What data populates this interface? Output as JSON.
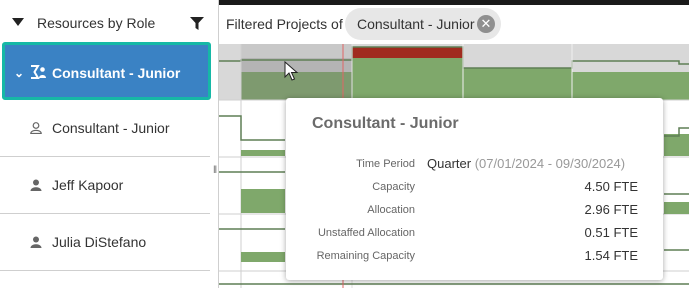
{
  "sidebar": {
    "title": "Resources by Role",
    "role_group": {
      "label": "Consultant - Junior",
      "expanded": true
    },
    "resources": [
      {
        "label": "Consultant - Junior",
        "icon": "person-outline-icon"
      },
      {
        "label": "Jeff Kapoor",
        "icon": "person-icon"
      },
      {
        "label": "Julia DiStefano",
        "icon": "person-icon"
      }
    ]
  },
  "header": {
    "filtered_label": "Filtered Projects of",
    "chip": {
      "label": "Consultant - Junior",
      "close_icon": "close-circle-icon"
    }
  },
  "tooltip": {
    "title": "Consultant - Junior",
    "time_period_label": "Time Period",
    "time_period_value": "Quarter",
    "time_period_range": "(07/01/2024 - 09/30/2024)",
    "rows": [
      {
        "label": "Capacity",
        "value": "4.50 FTE"
      },
      {
        "label": "Allocation",
        "value": "2.96 FTE"
      },
      {
        "label": "Unstaffed Allocation",
        "value": "0.51 FTE"
      },
      {
        "label": "Remaining Capacity",
        "value": "1.54 FTE"
      }
    ]
  },
  "colors": {
    "selected_row": "#3a82c4",
    "selection_border": "#16b8a6",
    "allocation_green": "#7fa86b",
    "over_allocation_red": "#a02b1f",
    "today_marker": "#e06666"
  }
}
